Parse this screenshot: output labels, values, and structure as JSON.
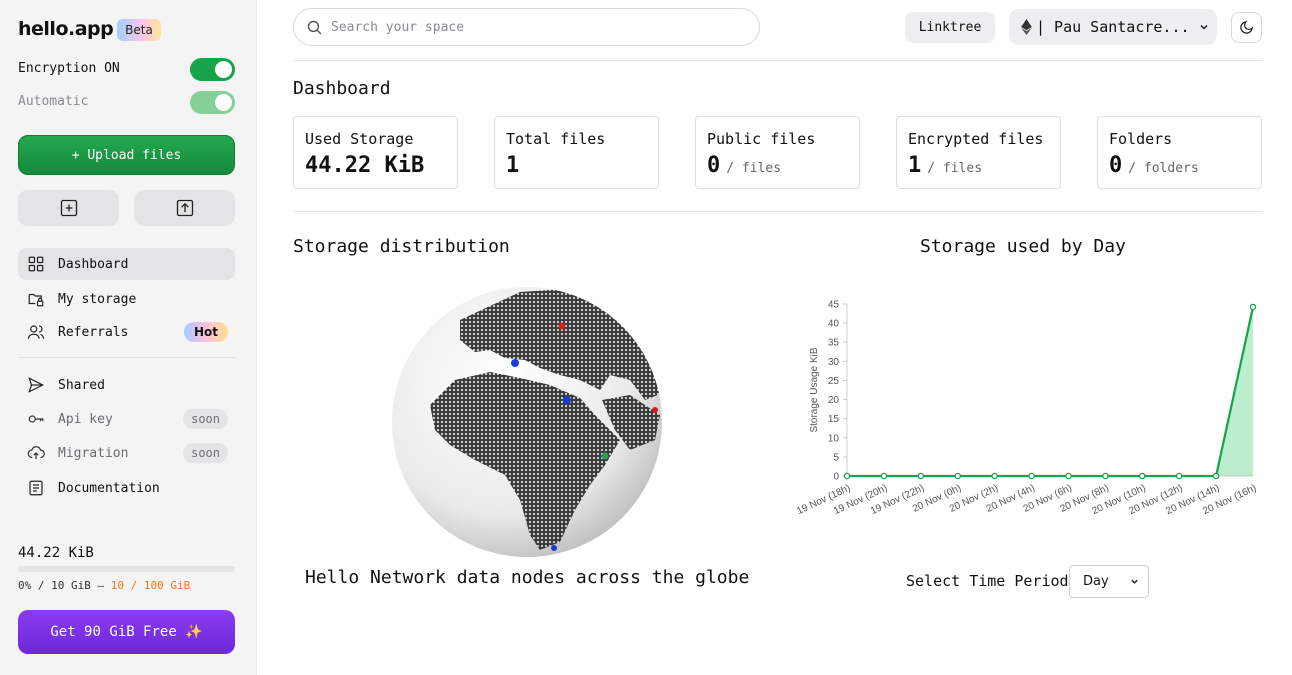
{
  "sidebar": {
    "logo": "hello.app",
    "beta_badge": "Beta",
    "encryption_label": "Encryption ON",
    "automatic_label": "Automatic",
    "upload_label": "+ Upload files",
    "nav": [
      {
        "label": "Dashboard",
        "icon": "grid-icon"
      },
      {
        "label": "My storage",
        "icon": "folder-lock-icon"
      },
      {
        "label": "Referrals",
        "icon": "users-icon",
        "badge": "Hot"
      },
      {
        "label": "Shared",
        "icon": "send-icon"
      },
      {
        "label": "Api key",
        "icon": "key-icon",
        "badge": "soon"
      },
      {
        "label": "Migration",
        "icon": "cloud-upload-icon",
        "badge": "soon"
      },
      {
        "label": "Documentation",
        "icon": "document-icon"
      }
    ],
    "usage_value": "44.22 KiB",
    "usage_percent": 0,
    "usage_line_prefix": "0% / 10 GiB –",
    "usage_line_highlight": "10 / 100 GiB",
    "free_button": "Get 90 GiB Free ✨"
  },
  "header": {
    "search_placeholder": "Search your space",
    "linktree": "Linktree",
    "wallet": "| Pau Santacre...",
    "colors": {
      "accent_green": "#16a34a",
      "accent_purple": "#7c3aed",
      "orange": "#f97316"
    }
  },
  "dashboard": {
    "title": "Dashboard",
    "cards": [
      {
        "label": "Used Storage",
        "value": "44.22 KiB",
        "unit": ""
      },
      {
        "label": "Total files",
        "value": "1",
        "unit": ""
      },
      {
        "label": "Public files",
        "value": "0",
        "unit": "/ files"
      },
      {
        "label": "Encrypted files",
        "value": "1",
        "unit": "/ files"
      },
      {
        "label": "Folders",
        "value": "0",
        "unit": "/ folders"
      }
    ],
    "distribution_title": "Storage distribution",
    "globe_caption": "Hello Network data nodes across the globe",
    "usage_title": "Storage used by Day",
    "period_label": "Select Time Period",
    "period_value": "Day"
  },
  "chart_data": {
    "type": "area",
    "x": [
      "19 Nov (18h)",
      "19 Nov (20h)",
      "19 Nov (22h)",
      "20 Nov (0h)",
      "20 Nov (2h)",
      "20 Nov (4h)",
      "20 Nov (6h)",
      "20 Nov (8h)",
      "20 Nov (10h)",
      "20 Nov (12h)",
      "20 Nov (14h)",
      "20 Nov (16h)"
    ],
    "values": [
      0,
      0,
      0,
      0,
      0,
      0,
      0,
      0,
      0,
      0,
      0,
      44.22
    ],
    "ylabel": "Storage Usage KiB",
    "ylim": [
      0,
      45
    ],
    "yticks": [
      0,
      5,
      10,
      15,
      20,
      25,
      30,
      35,
      40,
      45
    ],
    "color": "#16a34a",
    "grid": false
  }
}
